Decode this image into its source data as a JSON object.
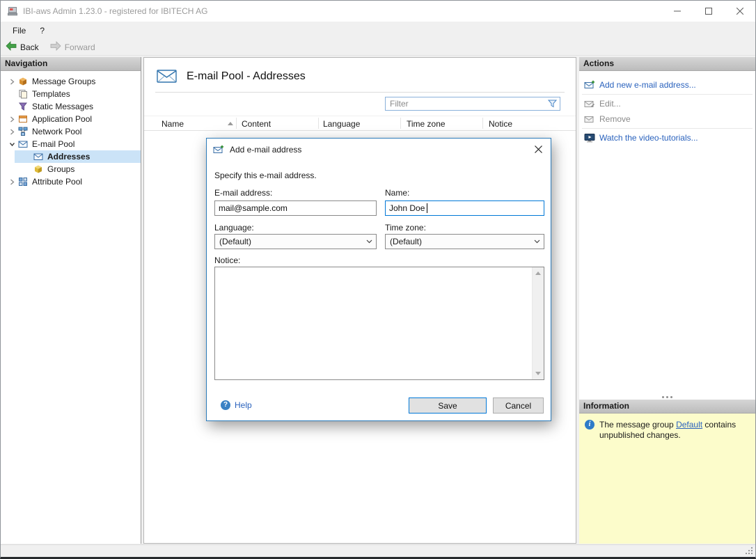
{
  "window": {
    "title": "IBI-aws Admin 1.23.0 - registered for IBITECH AG"
  },
  "menu": {
    "items": [
      {
        "label": "File"
      },
      {
        "label": "?"
      }
    ]
  },
  "toolbar": {
    "back_label": "Back",
    "forward_label": "Forward"
  },
  "navigation": {
    "header": "Navigation",
    "items": [
      {
        "label": "Message Groups",
        "icon": "cube-orange-icon",
        "state": "collapsed",
        "level": 0,
        "selected": false
      },
      {
        "label": "Templates",
        "icon": "templates-icon",
        "state": "leaf",
        "level": 0,
        "selected": false
      },
      {
        "label": "Static Messages",
        "icon": "funnel-purple-icon",
        "state": "leaf",
        "level": 0,
        "selected": false
      },
      {
        "label": "Application Pool",
        "icon": "app-window-icon",
        "state": "collapsed",
        "level": 0,
        "selected": false
      },
      {
        "label": "Network Pool",
        "icon": "network-icon",
        "state": "collapsed",
        "level": 0,
        "selected": false
      },
      {
        "label": "E-mail Pool",
        "icon": "envelope-icon",
        "state": "expanded",
        "level": 0,
        "selected": false
      },
      {
        "label": "Addresses",
        "icon": "envelope-icon",
        "state": "leaf",
        "level": 1,
        "selected": true
      },
      {
        "label": "Groups",
        "icon": "cube-yellow-icon",
        "state": "leaf",
        "level": 1,
        "selected": false
      },
      {
        "label": "Attribute Pool",
        "icon": "attribute-grid-icon",
        "state": "collapsed",
        "level": 0,
        "selected": false
      }
    ]
  },
  "main": {
    "title": "E-mail Pool - Addresses",
    "filter": {
      "placeholder": "Filter"
    },
    "table": {
      "columns": [
        "Name",
        "Content",
        "Language",
        "Time zone",
        "Notice"
      ],
      "sorted_column": "Name",
      "sort_direction": "asc",
      "rows": []
    }
  },
  "dialog": {
    "title": "Add e-mail address",
    "description": "Specify this e-mail address.",
    "email_label": "E-mail address:",
    "email_value": "mail@sample.com",
    "name_label": "Name:",
    "name_value": "John Doe",
    "language_label": "Language:",
    "language_value": "(Default)",
    "timezone_label": "Time zone:",
    "timezone_value": "(Default)",
    "notice_label": "Notice:",
    "notice_value": "",
    "help_label": "Help",
    "save_label": "Save",
    "cancel_label": "Cancel"
  },
  "actions": {
    "header": "Actions",
    "items": [
      {
        "label": "Add new e-mail address...",
        "icon": "envelope-add-icon",
        "enabled": true
      },
      {
        "label": "Edit...",
        "icon": "envelope-edit-icon",
        "enabled": false
      },
      {
        "label": "Remove",
        "icon": "envelope-remove-icon",
        "enabled": false
      },
      {
        "label": "Watch the video-tutorials...",
        "icon": "video-icon",
        "enabled": true
      }
    ]
  },
  "information": {
    "header": "Information",
    "text_before": "The message group ",
    "link_text": "Default",
    "text_after": " contains unpublished changes."
  },
  "colors": {
    "accent": "#0078d7",
    "link": "#2a62bd",
    "tree_selection": "#cbe3f7",
    "info_panel_bg": "#fcfccb",
    "panel_header_bg": "#c6c6c6"
  }
}
